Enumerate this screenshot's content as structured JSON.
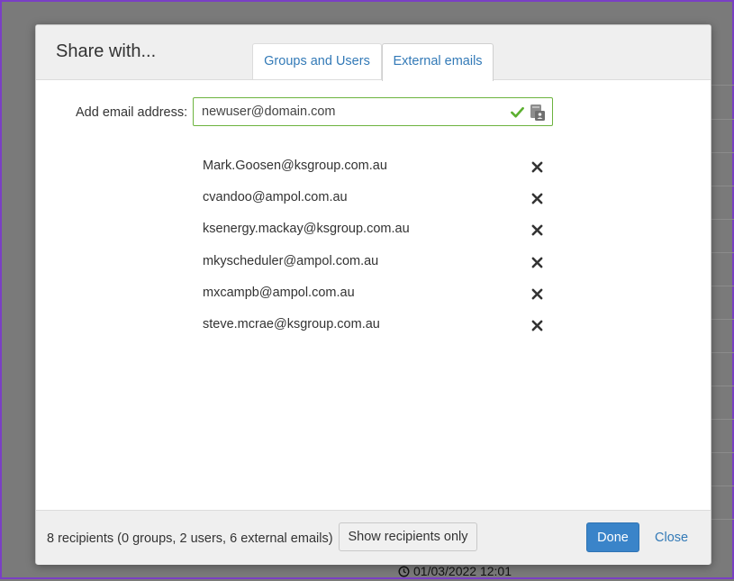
{
  "background": {
    "timestamp": "01/03/2022 12:01",
    "timestamp_icon": "clock-icon"
  },
  "dialog": {
    "title": "Share with...",
    "tabs": [
      {
        "label": "Groups and Users",
        "active": false
      },
      {
        "label": "External emails",
        "active": true
      }
    ],
    "add_email": {
      "label": "Add email address:",
      "value": "newuser@domain.com",
      "valid_icon": "check-icon",
      "address_book_icon": "address-book-icon"
    },
    "recipients": [
      "Mark.Goosen@ksgroup.com.au",
      "cvandoo@ampol.com.au",
      "ksenergy.mackay@ksgroup.com.au",
      "mkyscheduler@ampol.com.au",
      "mxcampb@ampol.com.au",
      "steve.mcrae@ksgroup.com.au"
    ],
    "footer": {
      "summary": "8 recipients (0 groups, 2 users, 6 external emails)",
      "show_recipients_label": "Show recipients only",
      "done_label": "Done",
      "close_label": "Close"
    }
  },
  "colors": {
    "accent": "#337ab7",
    "primary_button": "#3a84c9",
    "valid_border": "#6cb33e",
    "overlay": "#7a7a7a"
  }
}
